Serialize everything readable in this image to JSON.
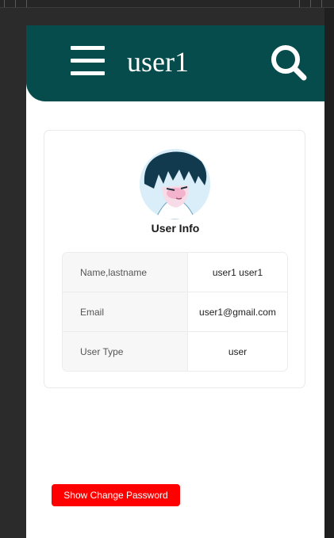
{
  "header": {
    "title": "user1",
    "menu_icon": "hamburger-menu-icon",
    "search_icon": "search-icon",
    "color": "#064c4c"
  },
  "card": {
    "title": "User Info",
    "avatar": "user-avatar",
    "rows": [
      {
        "label": "Name,lastname",
        "value": "user1 user1"
      },
      {
        "label": "Email",
        "value": "user1@gmail.com"
      },
      {
        "label": "User Type",
        "value": "user"
      }
    ]
  },
  "actions": {
    "change_password_label": "Show Change Password",
    "color": "#ff0000"
  }
}
